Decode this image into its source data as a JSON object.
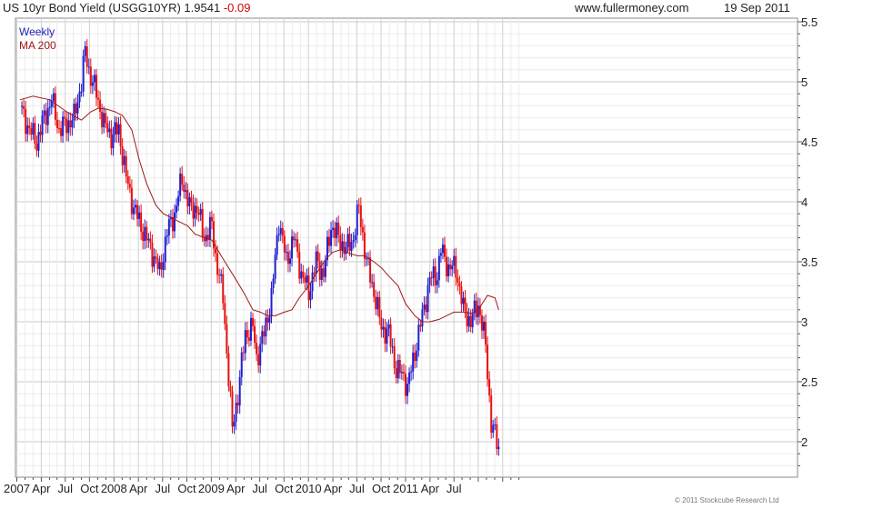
{
  "header": {
    "title": "US 10yr Bond Yield (USGG10YR) 1.9541",
    "change": "-0.09",
    "site": "www.fullermoney.com",
    "date": "19 Sep 2011"
  },
  "footer": {
    "copyright": "© 2011 Stockcube Research Ltd"
  },
  "chart_data": {
    "type": "line",
    "title": "US 10yr Bond Yield (USGG10YR) 1.9541 -0.09",
    "xlabel": "",
    "ylabel": "",
    "ylim": [
      1.8,
      5.5
    ],
    "grid": true,
    "legend_position": "top-left",
    "x_tick_labels": [
      "2007",
      "Apr",
      "Jul",
      "Oct",
      "2008",
      "Apr",
      "Jul",
      "Oct",
      "2009",
      "Apr",
      "Jul",
      "Oct",
      "2010",
      "Apr",
      "Jul",
      "Oct",
      "2011",
      "Apr",
      "Jul"
    ],
    "y_ticks": [
      2,
      2.5,
      3,
      3.5,
      4,
      4.5,
      5,
      5.5
    ],
    "series": [
      {
        "name": "Weekly",
        "kind": "weekly-close",
        "up_color": "#1f1fd0",
        "down_color": "#e81010",
        "x": [
          "2006-10-20",
          "2006-11-17",
          "2006-12-15",
          "2007-01-12",
          "2007-02-09",
          "2007-03-09",
          "2007-04-06",
          "2007-05-04",
          "2007-06-01",
          "2007-06-15",
          "2007-06-29",
          "2007-07-27",
          "2007-08-24",
          "2007-09-21",
          "2007-10-19",
          "2007-11-16",
          "2007-12-14",
          "2008-01-11",
          "2008-02-08",
          "2008-03-07",
          "2008-03-21",
          "2008-04-18",
          "2008-05-16",
          "2008-06-13",
          "2008-07-11",
          "2008-08-08",
          "2008-09-05",
          "2008-10-03",
          "2008-10-17",
          "2008-11-14",
          "2008-12-19",
          "2009-01-09",
          "2009-02-06",
          "2009-03-06",
          "2009-03-20",
          "2009-04-17",
          "2009-05-15",
          "2009-06-12",
          "2009-07-10",
          "2009-08-07",
          "2009-09-04",
          "2009-10-02",
          "2009-10-30",
          "2009-11-27",
          "2009-12-25",
          "2010-01-22",
          "2010-02-19",
          "2010-03-19",
          "2010-04-09",
          "2010-05-07",
          "2010-06-04",
          "2010-07-02",
          "2010-07-30",
          "2010-08-27",
          "2010-09-24",
          "2010-10-08",
          "2010-11-05",
          "2010-12-03",
          "2010-12-31",
          "2011-01-28",
          "2011-02-11",
          "2011-03-11",
          "2011-04-08",
          "2011-05-06",
          "2011-06-03",
          "2011-07-01",
          "2011-07-29",
          "2011-08-19",
          "2011-09-02",
          "2011-09-16"
        ],
        "values": [
          4.75,
          4.6,
          4.5,
          4.7,
          4.85,
          4.6,
          4.65,
          4.7,
          5.0,
          5.25,
          5.1,
          4.9,
          4.65,
          4.55,
          4.6,
          4.2,
          3.95,
          3.8,
          3.65,
          3.5,
          3.4,
          3.75,
          3.9,
          4.2,
          3.95,
          3.95,
          3.7,
          3.8,
          3.55,
          3.2,
          2.1,
          2.4,
          2.9,
          2.95,
          2.7,
          2.9,
          3.2,
          3.85,
          3.5,
          3.7,
          3.4,
          3.25,
          3.5,
          3.4,
          3.8,
          3.7,
          3.6,
          3.7,
          3.95,
          3.5,
          3.25,
          2.95,
          2.9,
          2.6,
          2.55,
          2.45,
          2.75,
          3.05,
          3.35,
          3.4,
          3.6,
          3.45,
          3.45,
          3.1,
          3.0,
          3.15,
          2.8,
          2.15,
          2.05,
          1.95
        ]
      },
      {
        "name": "MA 200",
        "kind": "moving-average",
        "color": "#a01818",
        "x": [
          "2006-10-13",
          "2006-12-01",
          "2007-02-02",
          "2007-04-06",
          "2007-06-01",
          "2007-07-06",
          "2007-08-03",
          "2007-09-07",
          "2007-10-05",
          "2007-11-02",
          "2007-12-07",
          "2008-01-04",
          "2008-02-01",
          "2008-03-07",
          "2008-04-04",
          "2008-05-02",
          "2008-06-06",
          "2008-07-04",
          "2008-08-01",
          "2008-09-05",
          "2008-10-03",
          "2008-11-07",
          "2008-12-05",
          "2009-01-02",
          "2009-02-06",
          "2009-03-06",
          "2009-04-03",
          "2009-05-01",
          "2009-05-29",
          "2009-07-03",
          "2009-07-31",
          "2009-08-28",
          "2009-10-02",
          "2009-10-30",
          "2009-12-04",
          "2010-01-01",
          "2010-01-29",
          "2010-03-05",
          "2010-04-02",
          "2010-04-30",
          "2010-06-04",
          "2010-07-02",
          "2010-07-30",
          "2010-09-03",
          "2010-10-01",
          "2010-11-05",
          "2010-12-03",
          "2010-12-31",
          "2011-02-04",
          "2011-03-04",
          "2011-04-01",
          "2011-05-06",
          "2011-06-03",
          "2011-07-01",
          "2011-08-05",
          "2011-09-02",
          "2011-09-16"
        ],
        "values": [
          4.85,
          4.88,
          4.85,
          4.75,
          4.68,
          4.75,
          4.78,
          4.77,
          4.75,
          4.72,
          4.6,
          4.35,
          4.15,
          3.97,
          3.9,
          3.87,
          3.83,
          3.8,
          3.73,
          3.7,
          3.68,
          3.55,
          3.45,
          3.35,
          3.22,
          3.1,
          3.08,
          3.05,
          3.05,
          3.08,
          3.1,
          3.2,
          3.3,
          3.4,
          3.52,
          3.58,
          3.6,
          3.57,
          3.55,
          3.55,
          3.5,
          3.45,
          3.38,
          3.3,
          3.15,
          3.05,
          3.0,
          3.0,
          3.02,
          3.05,
          3.08,
          3.08,
          3.07,
          3.1,
          3.22,
          3.2,
          3.1
        ]
      }
    ]
  }
}
